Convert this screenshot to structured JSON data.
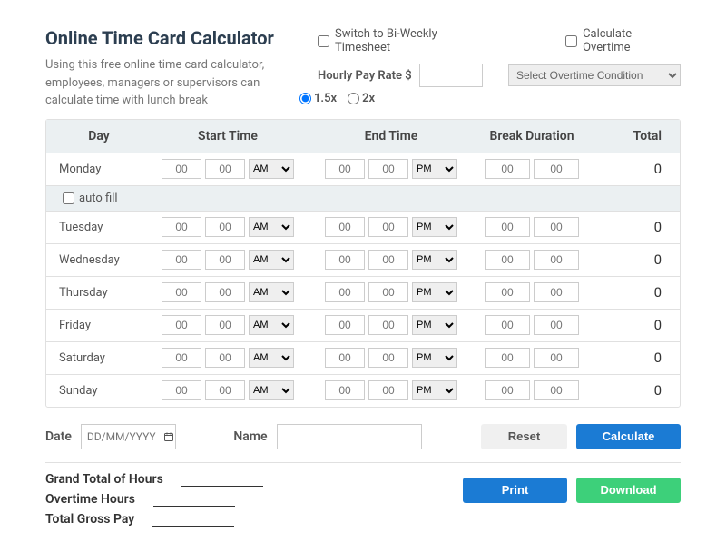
{
  "title": "Online Time Card Calculator",
  "blurb": "Using this free online time card calculator, employees, managers or supervisors can calculate time with lunch break",
  "switch_label": "Switch to Bi-Weekly Timesheet",
  "overtime_label": "Calculate Overtime",
  "rate_label": "Hourly Pay Rate $",
  "rate_value": "",
  "ot_select_placeholder": "Select Overtime Condition",
  "mult_15x": "1.5x",
  "mult_2x": "2x",
  "headers": {
    "day": "Day",
    "start": "Start Time",
    "end": "End Time",
    "break": "Break Duration",
    "total": "Total"
  },
  "autofill_label": "auto fill",
  "days": [
    {
      "name": "Monday",
      "sh": "00",
      "sm": "00",
      "sap": "AM",
      "eh": "00",
      "em": "00",
      "eap": "PM",
      "bh": "00",
      "bm": "00",
      "total": "0"
    },
    {
      "name": "Tuesday",
      "sh": "00",
      "sm": "00",
      "sap": "AM",
      "eh": "00",
      "em": "00",
      "eap": "PM",
      "bh": "00",
      "bm": "00",
      "total": "0"
    },
    {
      "name": "Wednesday",
      "sh": "00",
      "sm": "00",
      "sap": "AM",
      "eh": "00",
      "em": "00",
      "eap": "PM",
      "bh": "00",
      "bm": "00",
      "total": "0"
    },
    {
      "name": "Thursday",
      "sh": "00",
      "sm": "00",
      "sap": "AM",
      "eh": "00",
      "em": "00",
      "eap": "PM",
      "bh": "00",
      "bm": "00",
      "total": "0"
    },
    {
      "name": "Friday",
      "sh": "00",
      "sm": "00",
      "sap": "AM",
      "eh": "00",
      "em": "00",
      "eap": "PM",
      "bh": "00",
      "bm": "00",
      "total": "0"
    },
    {
      "name": "Saturday",
      "sh": "00",
      "sm": "00",
      "sap": "AM",
      "eh": "00",
      "em": "00",
      "eap": "PM",
      "bh": "00",
      "bm": "00",
      "total": "0"
    },
    {
      "name": "Sunday",
      "sh": "00",
      "sm": "00",
      "sap": "AM",
      "eh": "00",
      "em": "00",
      "eap": "PM",
      "bh": "00",
      "bm": "00",
      "total": "0"
    }
  ],
  "date_label": "Date",
  "date_placeholder": "DD/MM/YYYY",
  "name_label": "Name",
  "reset_label": "Reset",
  "calc_label": "Calculate",
  "grand_total_label": "Grand Total of Hours",
  "overtime_hours_label": "Overtime Hours",
  "gross_pay_label": "Total Gross Pay",
  "print_label": "Print",
  "download_label": "Download"
}
